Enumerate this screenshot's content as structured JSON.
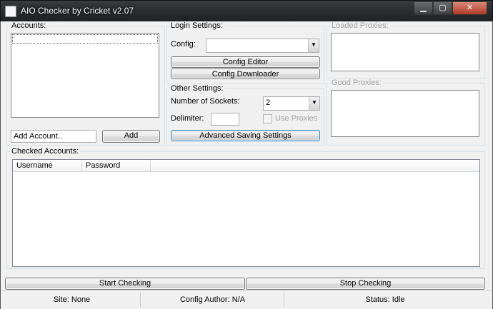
{
  "window": {
    "title": "AIO Checker by Cricket v2.07",
    "controls": {
      "minimize": "▁",
      "maximize": "▢",
      "close": "✕"
    }
  },
  "accounts": {
    "label": "Accounts:",
    "add_field_value": "Add Account..",
    "add_button": "Add"
  },
  "login_settings": {
    "label": "Login Settings:",
    "config_label": "Config:",
    "config_value": "",
    "config_editor_button": "Config Editor",
    "config_downloader_button": "Config Downloader"
  },
  "other_settings": {
    "label": "Other Settings:",
    "sockets_label": "Number of Sockets:",
    "sockets_value": "2",
    "delimiter_label": "Delimiter:",
    "delimiter_value": "",
    "use_proxies_label": "Use Proxies",
    "use_proxies_checked": false,
    "advanced_saving_button": "Advanced Saving Settings"
  },
  "proxies": {
    "loaded_label": "Loaded Proxies:",
    "good_label": "Good Proxies:"
  },
  "checked_accounts": {
    "label": "Checked Accounts:",
    "columns": [
      "Username",
      "Password"
    ]
  },
  "actions": {
    "start_button": "Start Checking",
    "stop_button": "Stop Checking"
  },
  "status_bar": {
    "site": "Site: None",
    "config_author": "Config Author: N/A",
    "status": "Status: Idle"
  }
}
